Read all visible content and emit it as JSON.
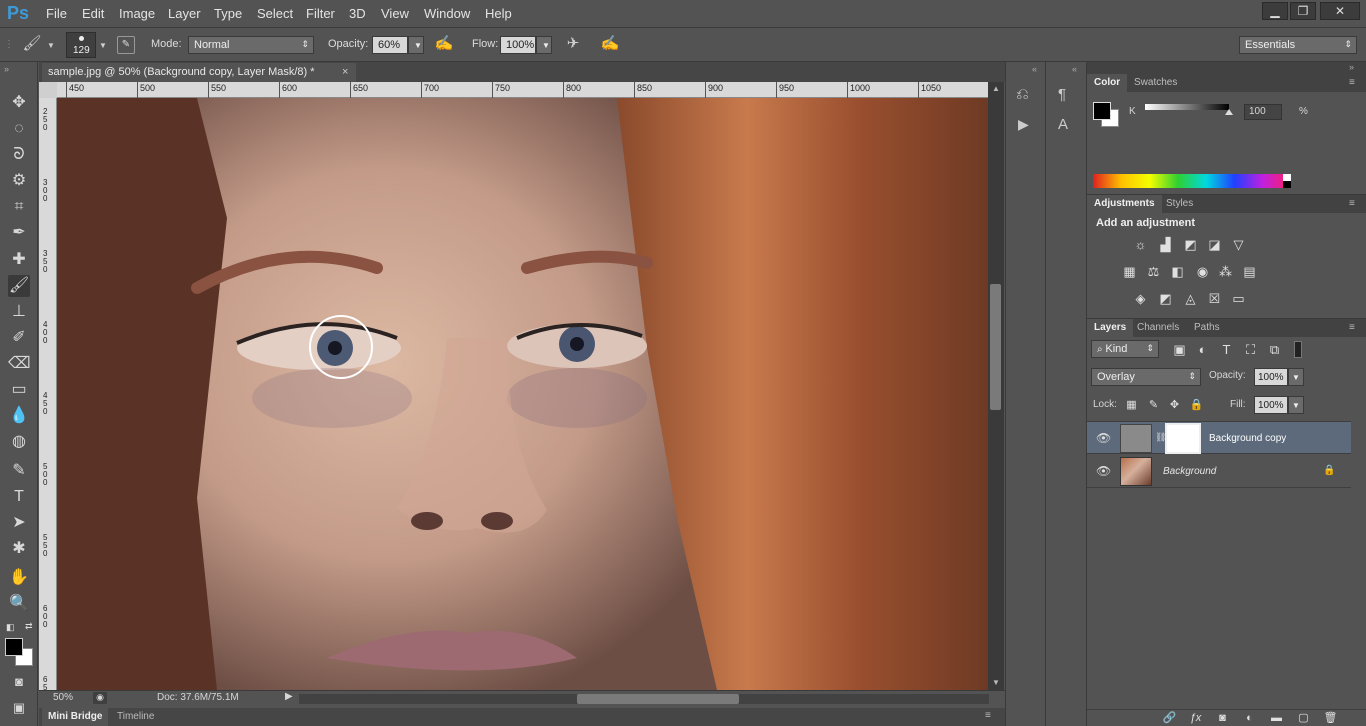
{
  "app": {
    "logo": "Ps"
  },
  "menu": [
    "File",
    "Edit",
    "Image",
    "Layer",
    "Type",
    "Select",
    "Filter",
    "3D",
    "View",
    "Window",
    "Help"
  ],
  "window_controls": {
    "minimize": "▁",
    "restore": "❐",
    "close": "✕"
  },
  "options": {
    "brush_size": "129",
    "mode_label": "Mode:",
    "mode_value": "Normal",
    "opacity_label": "Opacity:",
    "opacity_value": "60%",
    "flow_label": "Flow:",
    "flow_value": "100%",
    "workspace": "Essentials"
  },
  "document": {
    "tab_title": "sample.jpg @ 50% (Background copy, Layer Mask/8) *",
    "close": "×",
    "ruler_h": [
      "450",
      "500",
      "550",
      "600",
      "650",
      "700",
      "750",
      "800",
      "850",
      "900",
      "950",
      "1000",
      "1050"
    ],
    "ruler_v": [
      "2\n5\n0",
      "3\n0\n0",
      "3\n5\n0",
      "4\n0\n0",
      "4\n5\n0",
      "5\n0\n0",
      "5\n5\n0",
      "6\n0\n0",
      "6\n5\n0"
    ]
  },
  "status": {
    "zoom": "50%",
    "doc": "Doc: 37.6M/75.1M"
  },
  "bottom_tabs": [
    "Mini Bridge",
    "Timeline"
  ],
  "color_panel": {
    "tabs": [
      "Color",
      "Swatches"
    ],
    "channel_label": "K",
    "channel_value": "100",
    "unit": "%"
  },
  "adjustments_panel": {
    "tabs": [
      "Adjustments",
      "Styles"
    ],
    "heading": "Add an adjustment"
  },
  "layers_panel": {
    "tabs": [
      "Layers",
      "Channels",
      "Paths"
    ],
    "filter_kind": "Kind",
    "blend_mode": "Overlay",
    "opacity_label": "Opacity:",
    "opacity_value": "100%",
    "lock_label": "Lock:",
    "fill_label": "Fill:",
    "fill_value": "100%",
    "layers": [
      {
        "name": "Background copy",
        "selected": true
      },
      {
        "name": "Background",
        "selected": false,
        "locked": true
      }
    ]
  },
  "colors": {
    "accent": "#3d9bd8",
    "panel": "#535353",
    "dark": "#3a3a3a",
    "selected_layer": "#5c6a7c"
  }
}
